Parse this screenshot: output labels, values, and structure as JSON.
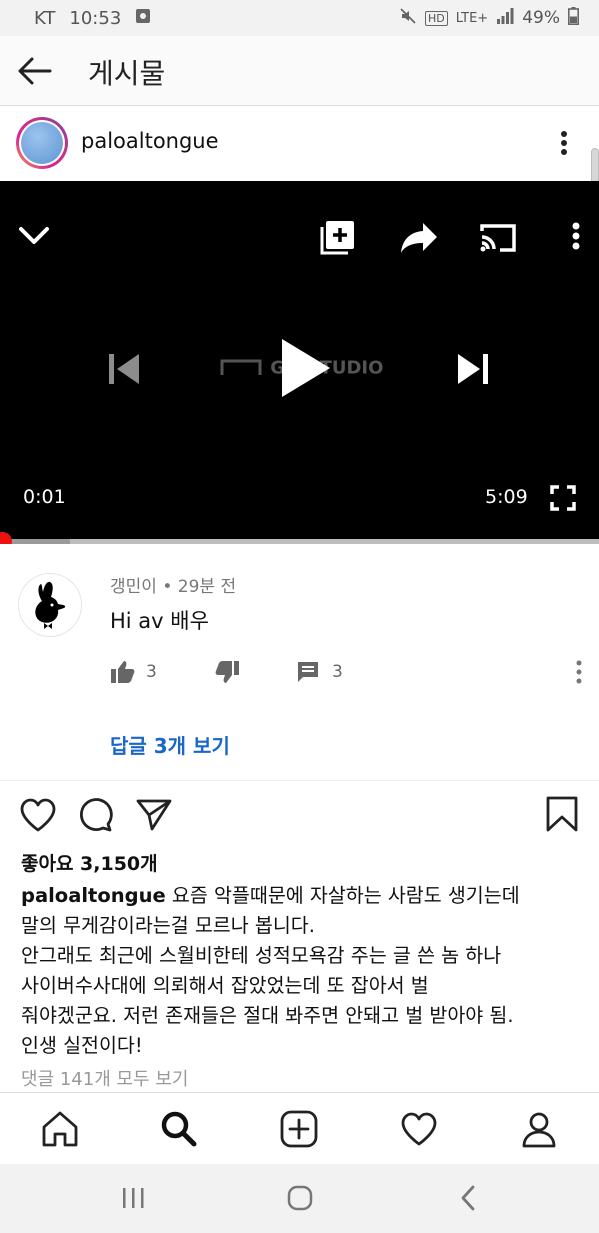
{
  "status_bar": {
    "carrier": "KT",
    "time": "10:53",
    "hd": "HD",
    "network": "LTE+",
    "battery": "49%"
  },
  "header": {
    "title": "게시물"
  },
  "post": {
    "username": "paloaltongue"
  },
  "video": {
    "watermark": "GO STUDIO",
    "current_time": "0:01",
    "duration": "5:09",
    "progress": 0.0032
  },
  "comment": {
    "author": "갱민이",
    "separator": "•",
    "time_ago": "29분 전",
    "text": "Hi av 배우",
    "likes": "3",
    "reply_count": "3",
    "view_replies": "답글 3개 보기"
  },
  "feed": {
    "likes_label": "좋아요 3,150개",
    "caption_username": "paloaltongue",
    "caption_lines": [
      " 요즘 악플때문에 자살하는 사람도 생기는데",
      "말의 무게감이라는걸 모르나 봅니다.",
      "안그래도 최근에 스월비한테 성적모욕감 주는 글 쓴 놈 하나",
      "사이버수사대에 의뢰해서 잡았었는데 또 잡아서 벌",
      "줘야겠군요. 저런 존재들은 절대 봐주면 안돼고 벌 받아야 됨.",
      "인생 실전이다!"
    ],
    "view_comments": "댓글 141개 모두 보기"
  },
  "icons": {
    "accent_blue": "#1a66c9",
    "progress_red": "#ee1111"
  }
}
